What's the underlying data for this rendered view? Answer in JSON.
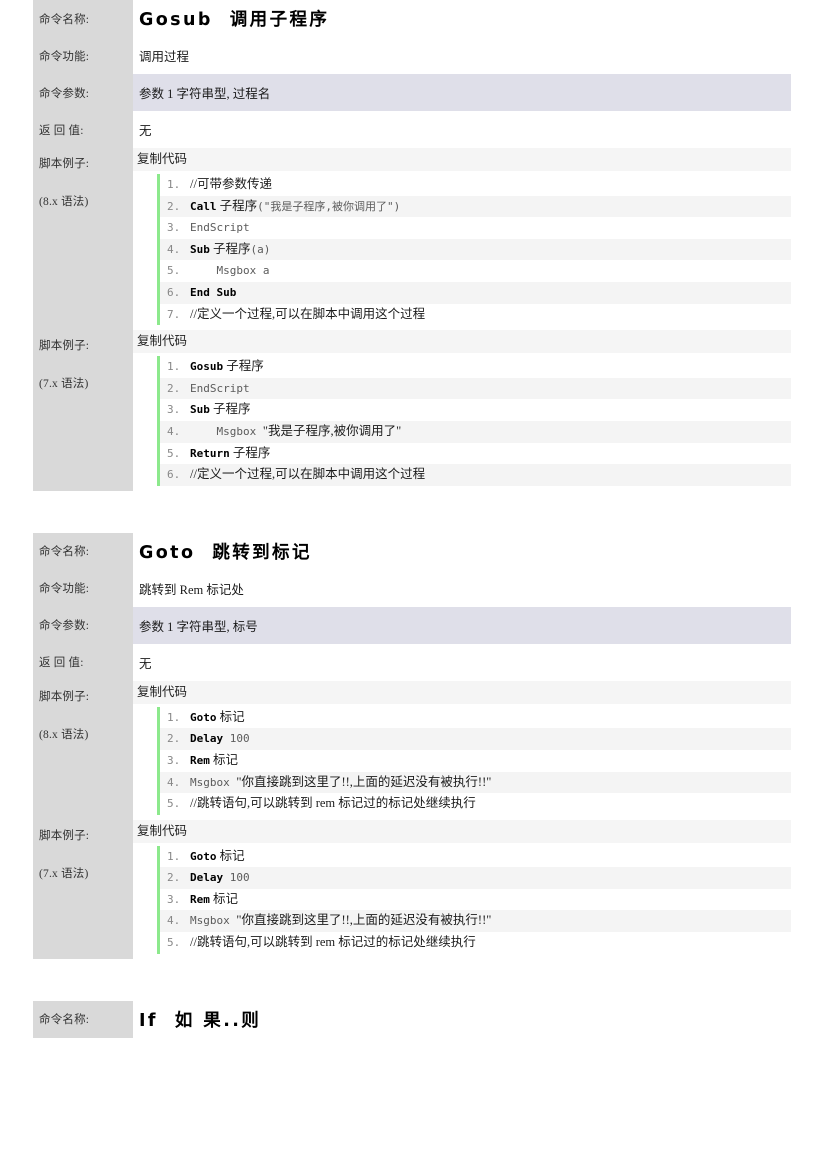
{
  "labels": {
    "name": "命令名称:",
    "func": "命令功能:",
    "params": "命令参数:",
    "ret": "返 回 值:",
    "example": "脚本例子:",
    "syntax8": "(8.x 语法)",
    "syntax7": "(7.x 语法)",
    "copy": "复制代码"
  },
  "sections": [
    {
      "title": "Gosub  调用子程序",
      "func": "调用过程",
      "params": "参数 1 字符串型, 过程名",
      "ret": "无",
      "examples": [
        {
          "syntax": "(8.x 语法)",
          "lines": [
            {
              "n": "1.",
              "parts": [
                {
                  "t": "comment",
                  "v": "//可带参数传递"
                }
              ]
            },
            {
              "n": "2.",
              "parts": [
                {
                  "t": "kw",
                  "v": "Call"
                },
                {
                  "t": "cn",
                  "v": " 子程序"
                },
                {
                  "t": "code",
                  "v": "(\"我是子程序,被你调用了\")"
                }
              ]
            },
            {
              "n": "3.",
              "parts": [
                {
                  "t": "code",
                  "v": "EndScript"
                }
              ]
            },
            {
              "n": "4.",
              "parts": [
                {
                  "t": "kw",
                  "v": "Sub"
                },
                {
                  "t": "cn",
                  "v": " 子程序"
                },
                {
                  "t": "code",
                  "v": "(a)"
                }
              ]
            },
            {
              "n": "5.",
              "parts": [
                {
                  "t": "code",
                  "v": "    Msgbox a"
                }
              ]
            },
            {
              "n": "6.",
              "parts": [
                {
                  "t": "kw",
                  "v": "End Sub"
                }
              ]
            },
            {
              "n": "7.",
              "parts": [
                {
                  "t": "comment",
                  "v": "//定义一个过程,可以在脚本中调用这个过程"
                }
              ]
            }
          ]
        },
        {
          "syntax": "(7.x 语法)",
          "lines": [
            {
              "n": "1.",
              "parts": [
                {
                  "t": "kw",
                  "v": "Gosub"
                },
                {
                  "t": "cn",
                  "v": " 子程序"
                }
              ]
            },
            {
              "n": "2.",
              "parts": [
                {
                  "t": "code",
                  "v": "EndScript"
                }
              ]
            },
            {
              "n": "3.",
              "parts": [
                {
                  "t": "kw",
                  "v": "Sub"
                },
                {
                  "t": "cn",
                  "v": " 子程序"
                }
              ]
            },
            {
              "n": "4.",
              "parts": [
                {
                  "t": "code",
                  "v": "    Msgbox "
                },
                {
                  "t": "cn",
                  "v": "\"我是子程序,被你调用了\""
                }
              ]
            },
            {
              "n": "5.",
              "parts": [
                {
                  "t": "kw",
                  "v": "Return"
                },
                {
                  "t": "cn",
                  "v": " 子程序"
                }
              ]
            },
            {
              "n": "6.",
              "parts": [
                {
                  "t": "comment",
                  "v": "//定义一个过程,可以在脚本中调用这个过程"
                }
              ]
            }
          ]
        }
      ]
    },
    {
      "title": "Goto  跳转到标记",
      "func": "跳转到 Rem 标记处",
      "params": "参数 1 字符串型, 标号",
      "ret": "无",
      "examples": [
        {
          "syntax": "(8.x 语法)",
          "lines": [
            {
              "n": "1.",
              "parts": [
                {
                  "t": "kw",
                  "v": "Goto"
                },
                {
                  "t": "cn",
                  "v": " 标记"
                }
              ]
            },
            {
              "n": "2.",
              "parts": [
                {
                  "t": "kw",
                  "v": "Delay"
                },
                {
                  "t": "code",
                  "v": " 100"
                }
              ]
            },
            {
              "n": "3.",
              "parts": [
                {
                  "t": "kw",
                  "v": "Rem"
                },
                {
                  "t": "cn",
                  "v": " 标记"
                }
              ]
            },
            {
              "n": "4.",
              "parts": [
                {
                  "t": "code",
                  "v": "Msgbox "
                },
                {
                  "t": "cn",
                  "v": "\"你直接跳到这里了!!,上面的延迟没有被执行!!\""
                }
              ]
            },
            {
              "n": "5.",
              "parts": [
                {
                  "t": "comment",
                  "v": "//跳转语句,可以跳转到 rem 标记过的标记处继续执行"
                }
              ]
            }
          ]
        },
        {
          "syntax": "(7.x 语法)",
          "lines": [
            {
              "n": "1.",
              "parts": [
                {
                  "t": "kw",
                  "v": "Goto"
                },
                {
                  "t": "cn",
                  "v": " 标记"
                }
              ]
            },
            {
              "n": "2.",
              "parts": [
                {
                  "t": "kw",
                  "v": "Delay"
                },
                {
                  "t": "code",
                  "v": " 100"
                }
              ]
            },
            {
              "n": "3.",
              "parts": [
                {
                  "t": "kw",
                  "v": "Rem"
                },
                {
                  "t": "cn",
                  "v": " 标记"
                }
              ]
            },
            {
              "n": "4.",
              "parts": [
                {
                  "t": "code",
                  "v": "Msgbox "
                },
                {
                  "t": "cn",
                  "v": "\"你直接跳到这里了!!,上面的延迟没有被执行!!\""
                }
              ]
            },
            {
              "n": "5.",
              "parts": [
                {
                  "t": "comment",
                  "v": "//跳转语句,可以跳转到 rem 标记过的标记处继续执行"
                }
              ]
            }
          ]
        }
      ]
    },
    {
      "title": "If  如 果..则",
      "func": "",
      "params": "",
      "ret": "",
      "examples": []
    }
  ]
}
